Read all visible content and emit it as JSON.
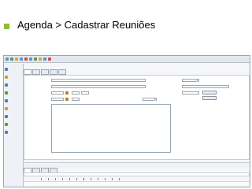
{
  "slide": {
    "title": "Agenda > Cadastrar Reuniões"
  }
}
